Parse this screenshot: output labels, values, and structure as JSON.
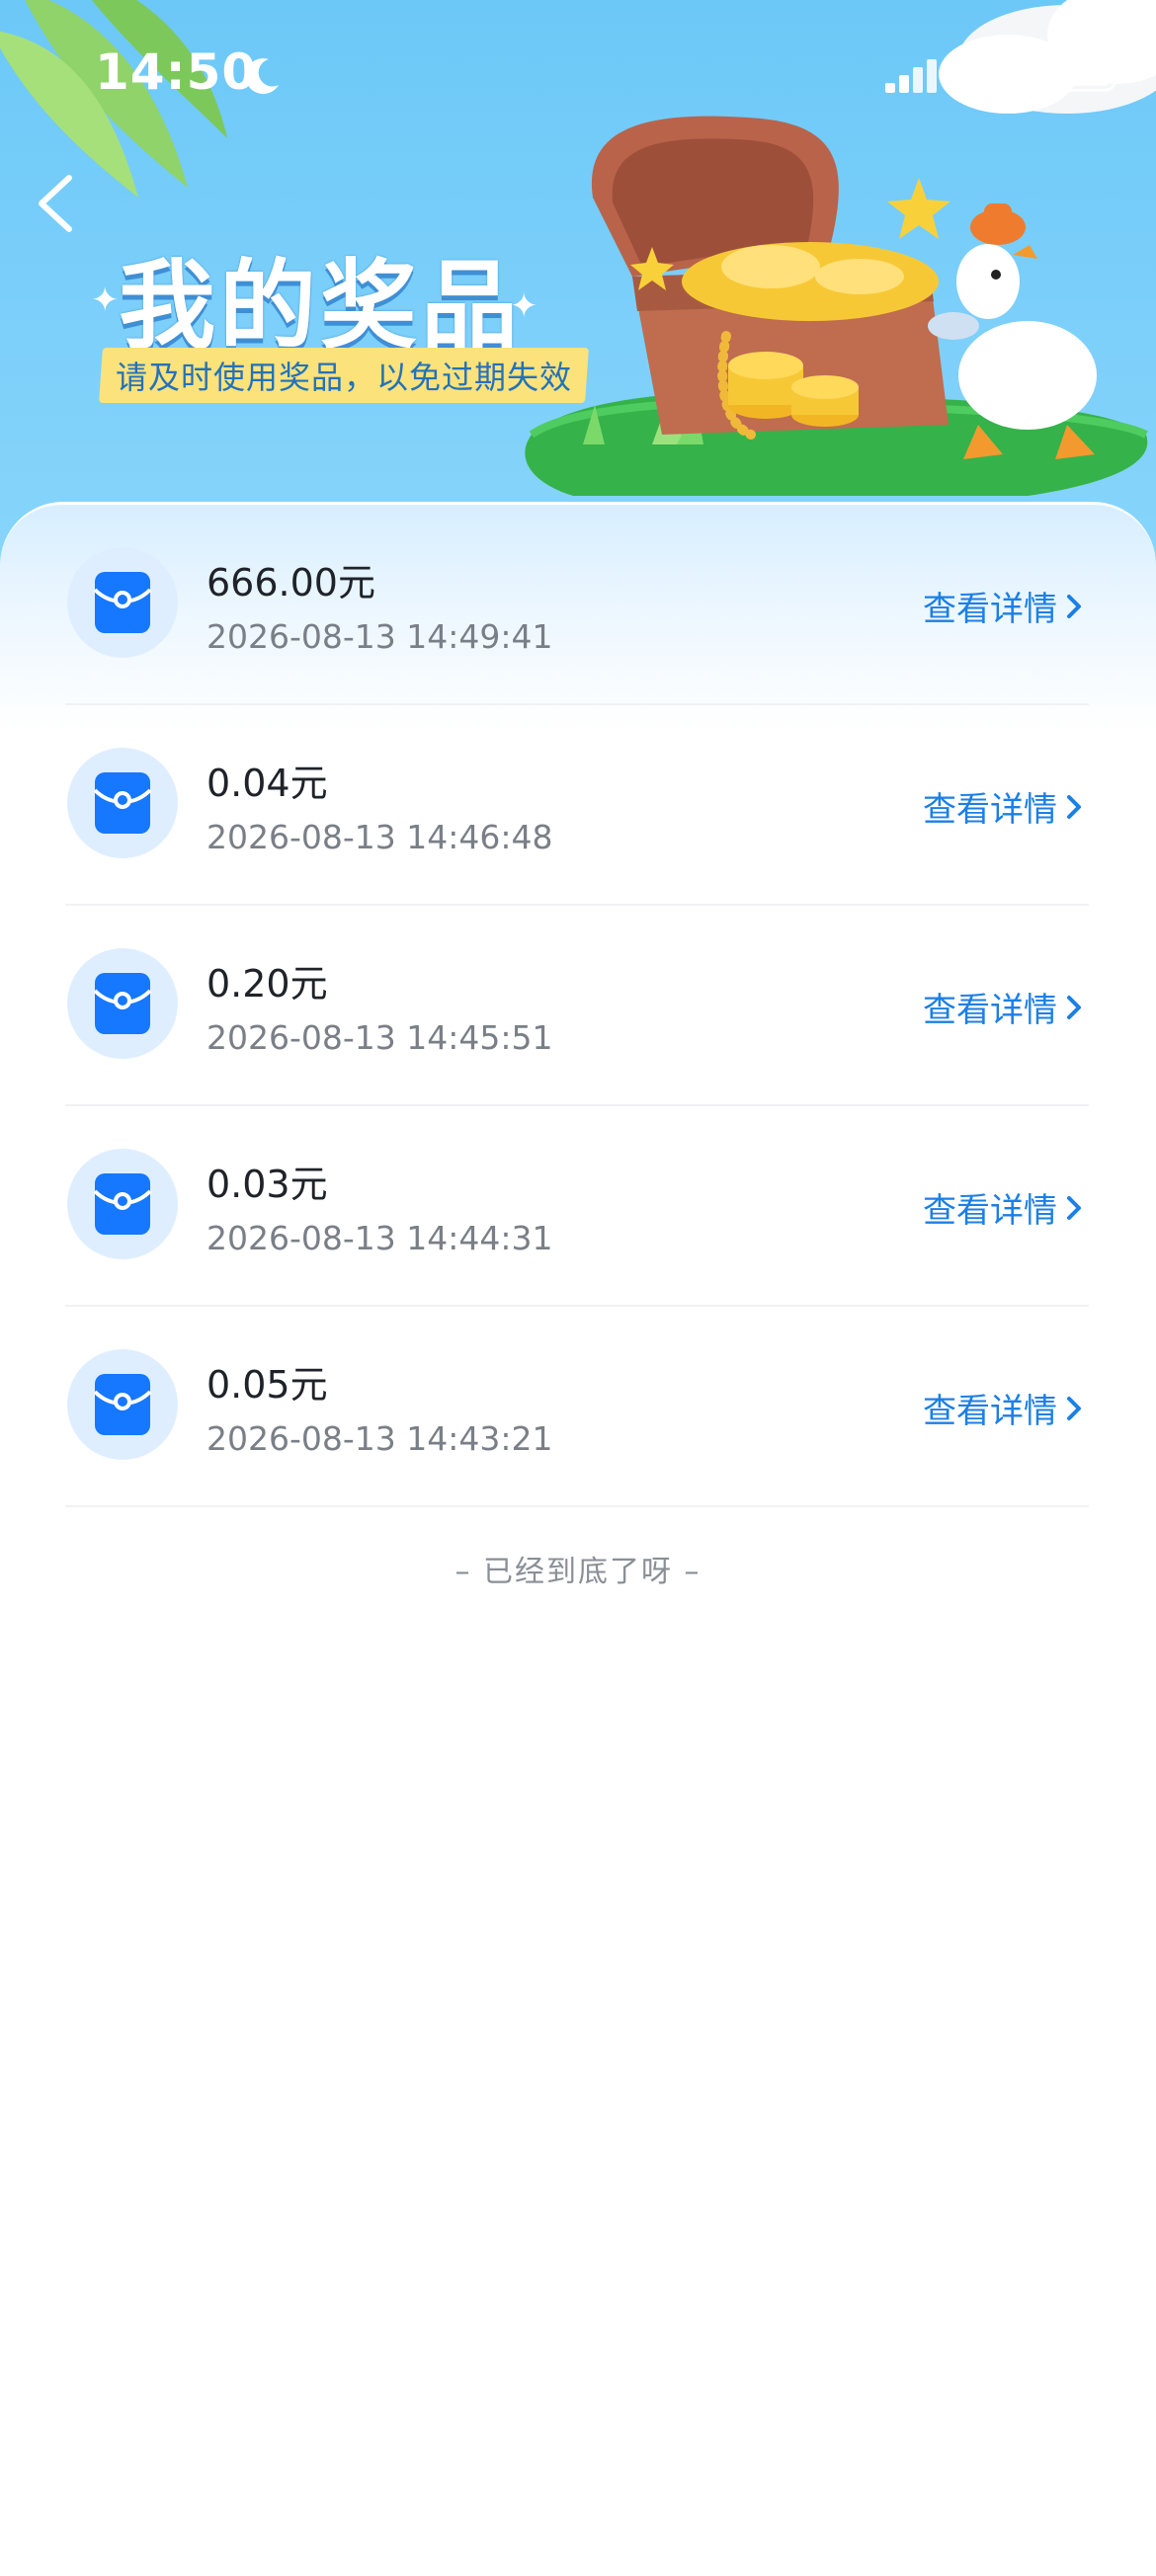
{
  "status_bar": {
    "time": "14:50",
    "moon_icon": "moon-icon",
    "signal_icon": "cellular-signal-icon",
    "wifi_icon": "wifi-icon",
    "battery_icon": "battery-icon"
  },
  "header": {
    "title": "我的奖品",
    "subtitle": "请及时使用奖品，以免过期失效",
    "back_icon": "back-arrow-icon",
    "colors": {
      "sky": "#7dd0fa",
      "subtitle_bg": "#fbe27b",
      "subtitle_text": "#2472b8"
    }
  },
  "prizes": [
    {
      "amount": "666.00元",
      "time": "2026-08-13 14:49:41",
      "link": "查看详情"
    },
    {
      "amount": "0.04元",
      "time": "2026-08-13 14:46:48",
      "link": "查看详情"
    },
    {
      "amount": "0.20元",
      "time": "2026-08-13 14:45:51",
      "link": "查看详情"
    },
    {
      "amount": "0.03元",
      "time": "2026-08-13 14:44:31",
      "link": "查看详情"
    },
    {
      "amount": "0.05元",
      "time": "2026-08-13 14:43:21",
      "link": "查看详情"
    }
  ],
  "footer": {
    "end_text": "– 已经到底了呀 –"
  },
  "colors": {
    "accent": "#1c7fe6",
    "icon_bg": "#dfeeff",
    "icon_fill": "#1677ff"
  }
}
